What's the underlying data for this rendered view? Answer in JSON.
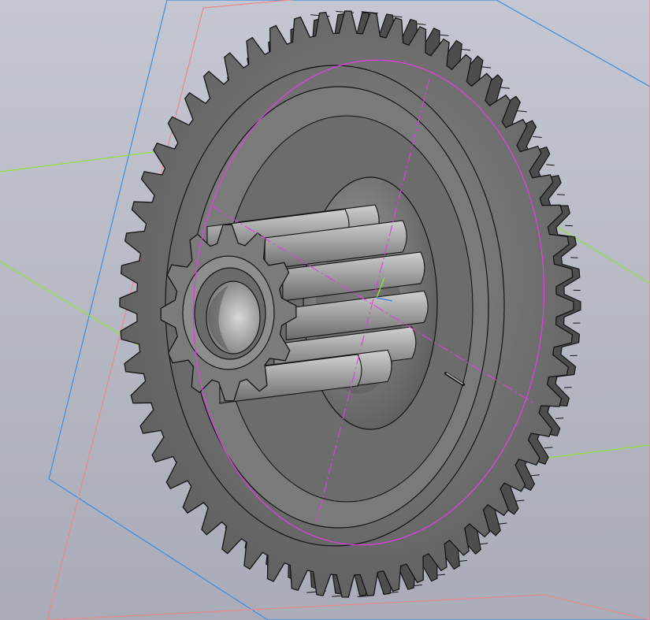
{
  "viewport": {
    "background_top": "#c4c7d1",
    "background_bottom": "#a9acb8",
    "colors": {
      "gear_face": "#6d6d6d",
      "gear_face_light": "#8a8a8a",
      "gear_dark": "#4a4a4a",
      "pinion_light": "#b5b5b5",
      "pinion_mid": "#8c8c8c",
      "edge": "#141414",
      "plane_blue": "#3a8ee0",
      "plane_red": "#e98a8a",
      "plane_green": "#8fe040",
      "sketch_magenta": "#e040e0",
      "axis_blue": "#2f7fd8"
    }
  },
  "model": {
    "large_gear_teeth": 56,
    "pinion_teeth": 12
  }
}
